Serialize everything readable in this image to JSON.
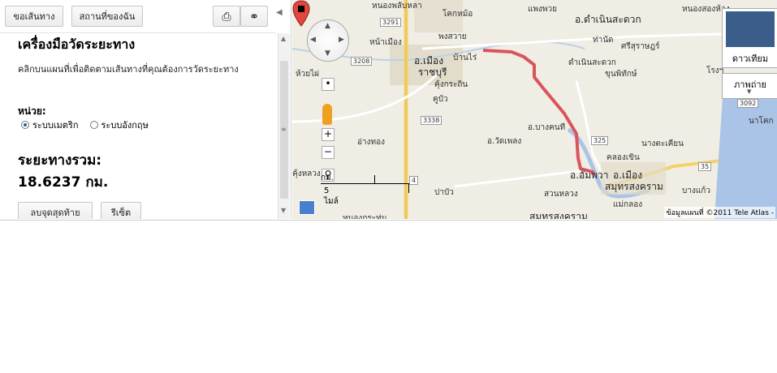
{
  "toolbar": {
    "directions_label": "ขอเส้นทาง",
    "my_places_label": "สถานที่ของฉัน",
    "print_icon": "printer-icon",
    "link_icon": "link-icon"
  },
  "panel": {
    "title": "เครื่องมือวัดระยะทาง",
    "description": "คลิกบนแผนที่เพื่อติดตามเส้นทางที่คุณต้องการวัดระยะทาง",
    "unit_label": "หน่วย:",
    "unit_options": [
      {
        "label": "ระบบเมตริก",
        "selected": true
      },
      {
        "label": "ระบบอังกฤษ",
        "selected": false
      }
    ],
    "total_label": "ระยะทางรวม:",
    "total_value": "18.6237 กม.",
    "undo_label": "ลบจุดสุดท้าย",
    "reset_label": "รีเซ็ต"
  },
  "map": {
    "labels": {
      "l1": "หนองพลับหลา",
      "l2": "โคกหม้อ",
      "l3": "แพงพวย",
      "l4": "หนองสองห้อง",
      "l5": "อ.ดำเนินสะดวก",
      "l6": "พงสวาย",
      "l7": "หน้าเมือง",
      "l8": "อ.เมือง",
      "l9": "ราชบุรี",
      "l10": "บ้านไร่",
      "l11": "ท่านัด",
      "l12": "ศรีสุราษฎร์",
      "l13": "ดำเนินสะดวก",
      "l14": "ห้วยไผ่",
      "l15": "คุ้งกระถิน",
      "l16": "ขุนพิทักษ์",
      "l17": "คูบัว",
      "l18": "อ.บางคนที",
      "l19": "อ่างทอง",
      "l20": "อ.วัดเพลง",
      "l21": "นางตะเคียน",
      "l22": "คลองเขิน",
      "l23": "คุ้งหลวง",
      "l24": "อ.อัมพวา",
      "l25": "อ.เมือง",
      "l26": "สมุทรสงคราม",
      "l27": "บางแก้ว",
      "l28": "ปาบัว",
      "l29": "สวนหลวง",
      "l30": "แม่กลอง",
      "l31": "หนองกระทุ่ม",
      "l32": "สมุทรสงคราม",
      "l33": "โรงฯ",
      "l34": "นาโคก"
    },
    "road_numbers": [
      "3291",
      "3208",
      "3338",
      "325",
      "35",
      "4",
      "3092"
    ],
    "maptype_satellite": "ดาวเทียม",
    "maptype_photo": "ภาพถ่าย",
    "scale_km": "กม.",
    "scale_mi": "5 ไมล์",
    "copyright": "ข้อมูลแผนที่ ©2011 Tele Atlas -",
    "route_color": "#d9545b",
    "start_color": "#3aa63a",
    "end_color": "#e2463f"
  }
}
